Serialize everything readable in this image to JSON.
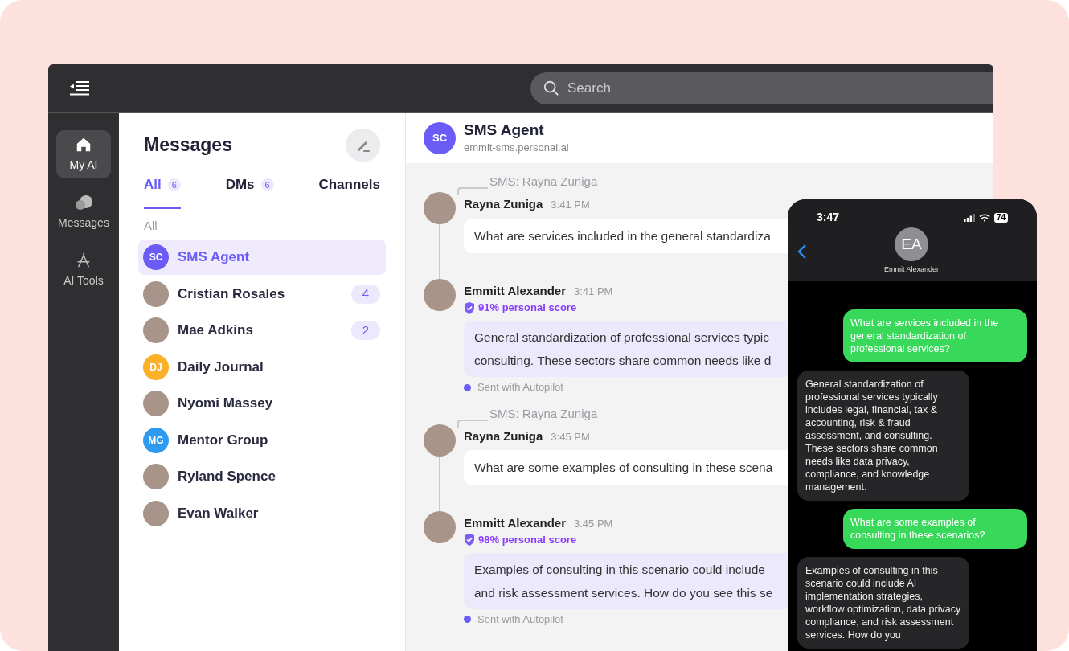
{
  "topbar": {
    "search": {
      "placeholder": "Search"
    }
  },
  "rail": [
    {
      "label": "My AI",
      "selected": true
    },
    {
      "label": "Messages",
      "selected": false
    },
    {
      "label": "AI Tools",
      "selected": false
    }
  ],
  "messages_panel": {
    "title": "Messages",
    "tabs": [
      {
        "label": "All",
        "count": "6",
        "selected": true
      },
      {
        "label": "DMs",
        "count": "6",
        "selected": false
      },
      {
        "label": "Channels",
        "selected": false
      }
    ],
    "section_label": "All",
    "conversations": [
      {
        "name": "SMS Agent",
        "kind": "initials",
        "initials": "SC",
        "color": "#6b5cf6",
        "selected": true
      },
      {
        "name": "Cristian Rosales",
        "kind": "photo",
        "badge": "4",
        "selected": false
      },
      {
        "name": "Mae Adkins",
        "kind": "photo",
        "badge": "2",
        "selected": false
      },
      {
        "name": "Daily Journal",
        "kind": "initials",
        "initials": "DJ",
        "color": "#fbb028",
        "selected": false
      },
      {
        "name": "Nyomi Massey",
        "kind": "photo",
        "selected": false
      },
      {
        "name": "Mentor Group",
        "kind": "initials",
        "initials": "MG",
        "color": "#2e9bf0",
        "selected": false
      },
      {
        "name": "Ryland Spence",
        "kind": "photo",
        "selected": false
      },
      {
        "name": "Evan Walker",
        "kind": "photo",
        "selected": false
      }
    ]
  },
  "chat": {
    "header": {
      "initials": "SC",
      "title": "SMS Agent",
      "subtitle": "emmit-sms.personal.ai"
    },
    "threads": [
      {
        "label": "SMS: Rayna Zuniga",
        "messages": [
          {
            "kind": "incoming",
            "sender": "Rayna Zuniga",
            "time": "3:41 PM",
            "lines": [
              "What are services included in the general standardiza"
            ]
          },
          {
            "kind": "agent",
            "sender": "Emmitt Alexander",
            "time": "3:41 PM",
            "score": "91% personal score",
            "lines": [
              "General standardization of professional services typic",
              "consulting. These sectors share common needs like d"
            ],
            "footer": "Sent with Autopilot"
          }
        ]
      },
      {
        "label": "SMS: Rayna Zuniga",
        "messages": [
          {
            "kind": "incoming",
            "sender": "Rayna Zuniga",
            "time": "3:45 PM",
            "lines": [
              "What are some examples of consulting in these scena"
            ]
          },
          {
            "kind": "agent",
            "sender": "Emmitt Alexander",
            "time": "3:45 PM",
            "score": "98% personal score",
            "lines": [
              "Examples of consulting in this scenario could include",
              "and risk assessment services. How do you see this se"
            ],
            "footer": "Sent with Autopilot"
          }
        ]
      }
    ]
  },
  "phone": {
    "time": "3:47",
    "battery": "74",
    "contact_initials": "EA",
    "contact_name": "Emmit Alexander",
    "messages": [
      {
        "kind": "sent",
        "text": "What are services included in the general standardization of professional services?"
      },
      {
        "kind": "received",
        "text": "General standardization of professional services typically includes legal, financial, tax & accounting, risk & fraud assessment, and consulting. These sectors share common needs like data privacy, compliance, and knowledge management."
      },
      {
        "kind": "sent",
        "text": "What are some examples of consulting in these scenarios?"
      },
      {
        "kind": "received",
        "text": "Examples of consulting in this scenario could include AI implementation strategies, workflow optimization, data privacy compliance, and risk assessment services. How do you"
      }
    ]
  }
}
